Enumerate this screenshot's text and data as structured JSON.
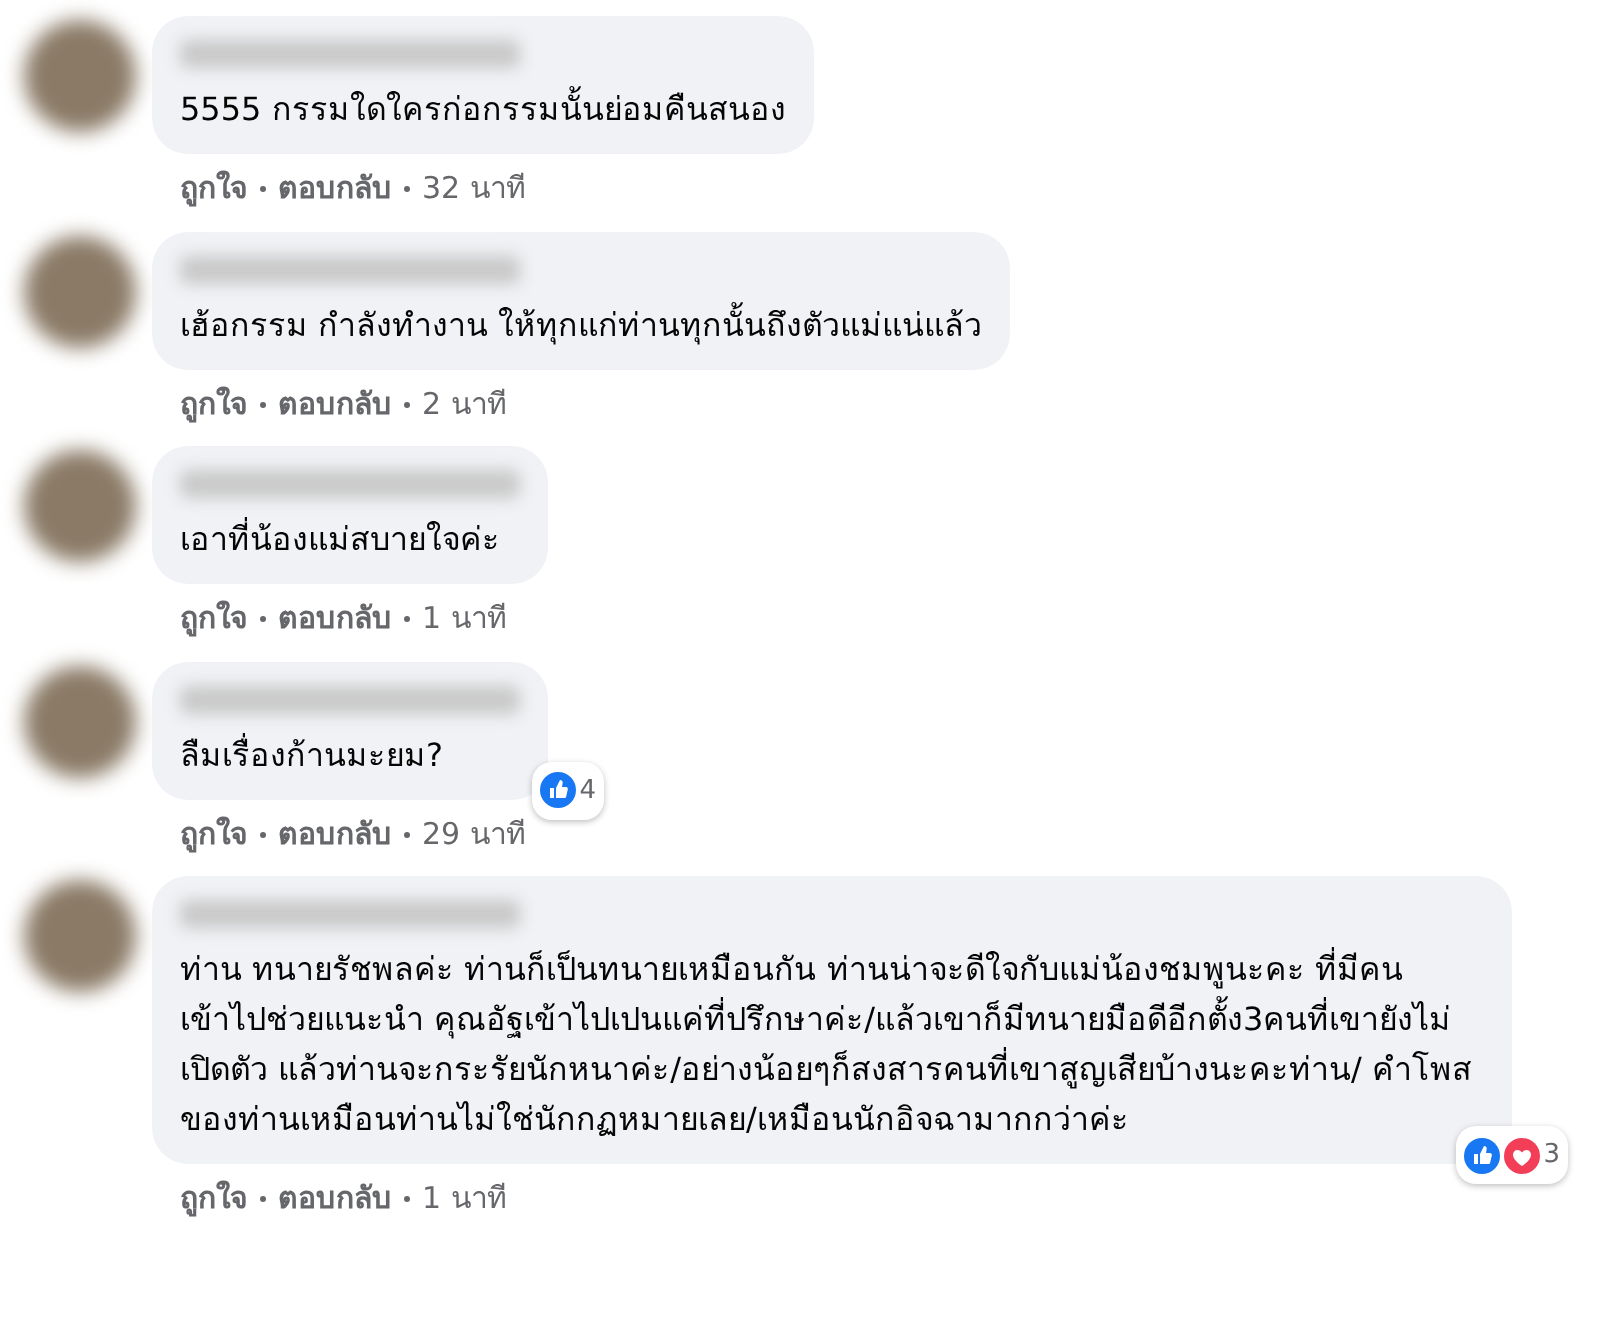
{
  "comments": [
    {
      "text": "5555 กรรมใดใครก่อกรรมนั้นย่อมคืนสนอง",
      "actions": [
        "ถูกใจ",
        "ตอบกลับ"
      ],
      "time": "32 นาที"
    },
    {
      "text": "เฮ้อกรรม กำลังทำงาน ให้ทุกแก่ท่านทุกนั้นถึงตัวแม่แน่แล้ว",
      "actions": [
        "ถูกใจ",
        "ตอบกลับ"
      ],
      "time": "2 นาที"
    },
    {
      "text": "เอาที่น้องแม่สบายใจค่ะ",
      "actions": [
        "ถูกใจ",
        "ตอบกลับ"
      ],
      "time": "1 นาที"
    },
    {
      "text": "ลืมเรื่องก้านมะยม?",
      "reactions": {
        "icons": [
          {
            "kind": "like"
          }
        ],
        "count": "4"
      },
      "actions": [
        "ถูกใจ",
        "ตอบกลับ"
      ],
      "time": "29 นาที"
    },
    {
      "text": "ท่าน ทนายรัชพลค่ะ ท่านก็เป็นทนายเหมือนกัน ท่านน่าจะดีใจกับแม่น้องชมพูนะคะ ที่มีคนเข้าไปช่วยแนะนำ คุณอัฐเข้าไปเปนแค่ที่ปรึกษาค่ะ/แล้วเขาก็มีทนายมือดีอีกตั้ง3คนที่เขายังไม่เปิดตัว แล้วท่านจะกระรัยนักหนาค่ะ/อย่างน้อยๆก็สงสารคนที่เขาสูญเสียบ้างนะคะท่าน/ คำโพสของท่านเหมือนท่านไม่ใช่นักกฏหมายเลย/เหมือนนักอิจฉามากกว่าค่ะ",
      "reactions": {
        "icons": [
          {
            "kind": "like"
          },
          {
            "kind": "love"
          }
        ],
        "count": "3"
      },
      "actions": [
        "ถูกใจ",
        "ตอบกลับ"
      ],
      "time": "1 นาที"
    }
  ]
}
